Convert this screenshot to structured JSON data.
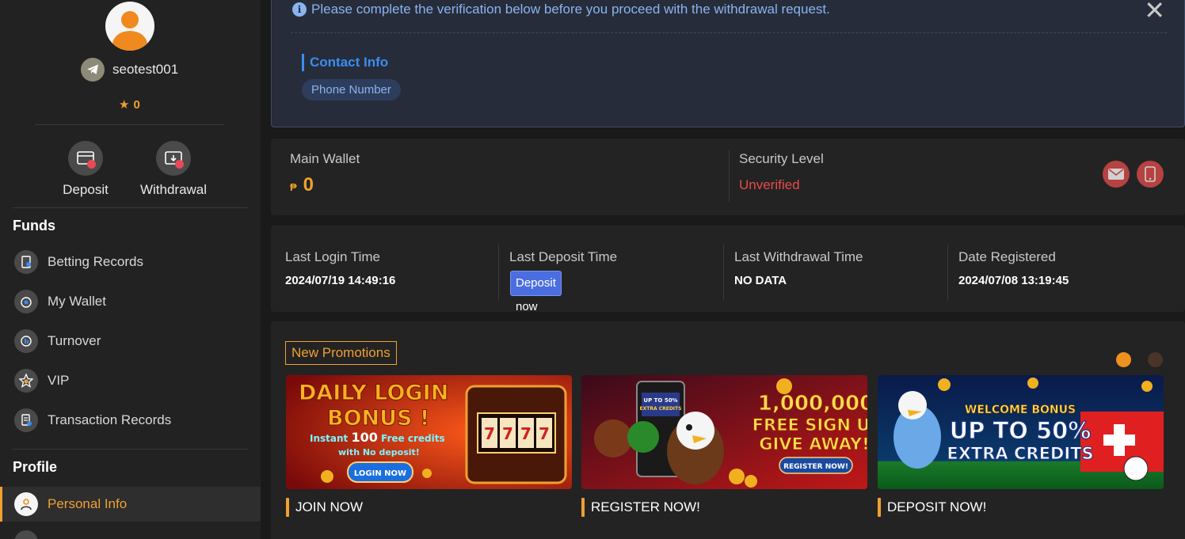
{
  "profile": {
    "username": "seotest001",
    "points": "0"
  },
  "quick_actions": {
    "deposit_label": "Deposit",
    "withdrawal_label": "Withdrawal"
  },
  "sidebar": {
    "funds_heading": "Funds",
    "funds_items": [
      {
        "label": "Betting Records",
        "icon": "receipt-icon"
      },
      {
        "label": "My Wallet",
        "icon": "wallet-icon"
      },
      {
        "label": "Turnover",
        "icon": "turnover-icon"
      },
      {
        "label": "VIP",
        "icon": "vip-star-icon"
      },
      {
        "label": "Transaction Records",
        "icon": "transaction-icon"
      }
    ],
    "profile_heading": "Profile",
    "profile_items": [
      {
        "label": "Personal Info",
        "icon": "user-icon",
        "active": true
      }
    ]
  },
  "verification": {
    "message": "Please complete the verification below before you proceed with the withdrawal request.",
    "contact_heading": "Contact Info",
    "phone_pill": "Phone Number"
  },
  "wallet": {
    "main_label": "Main Wallet",
    "currency": "₱",
    "main_value": "0",
    "security_label": "Security Level",
    "security_value": "Unverified"
  },
  "times": {
    "last_login_label": "Last Login Time",
    "last_login_value": "2024/07/19 14:49:16",
    "last_deposit_label": "Last Deposit Time",
    "deposit_now_label": "Deposit now",
    "last_withdrawal_label": "Last Withdrawal Time",
    "last_withdrawal_value": "NO DATA",
    "registered_label": "Date Registered",
    "registered_value": "2024/07/08 13:19:45"
  },
  "promotions": {
    "heading": "New Promotions",
    "items": [
      {
        "caption": "JOIN NOW",
        "banner_line1": "DAILY LOGIN",
        "banner_line2": "BONUS !",
        "banner_sub_a": "Instant ",
        "banner_sub_b": "100",
        "banner_sub_c": " Free credits",
        "banner_sub2": "with No deposit!",
        "banner_btn": "LOGIN NOW"
      },
      {
        "caption": "REGISTER NOW!",
        "banner_line1": "1,000,000",
        "banner_line2": "FREE SIGN U",
        "banner_line3": "GIVE AWAY!",
        "banner_btn": "REGISTER NOW!",
        "phone_text1": "UP TO 50%",
        "phone_text2": "EXTRA CREDITS"
      },
      {
        "caption": "DEPOSIT NOW!",
        "banner_line1": "WELCOME BONUS",
        "banner_line2": "UP TO 50%",
        "banner_line3": "EXTRA CREDITS"
      }
    ]
  },
  "colors": {
    "accent": "#f0a030",
    "info_blue": "#8ab4ee",
    "danger": "#e94a4a"
  }
}
